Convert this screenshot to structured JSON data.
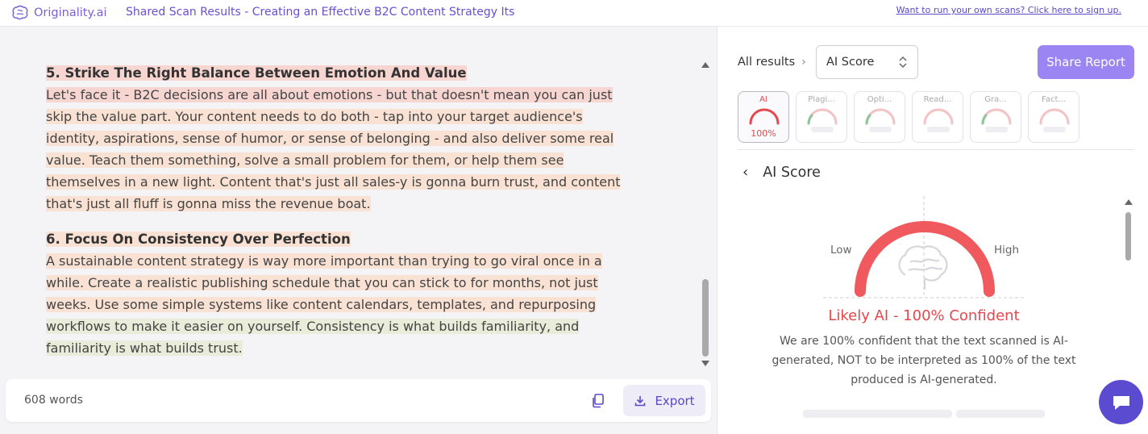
{
  "header": {
    "logo_text": "Originality.ai",
    "title": "Shared Scan Results - Creating an Effective B2C Content Strategy Its",
    "signup_link": "Want to run your own scans? Click here to sign up."
  },
  "document": {
    "section5": {
      "heading": "5. Strike The Right Balance Between Emotion And Value",
      "lines": [
        "Let's face it - B2C decisions are all about emotions - but that doesn't mean you can just",
        "skip the value part. Your content needs to do both - tap into your target audience's",
        "identity, aspirations, sense of humor, or sense of belonging - and also deliver some real",
        "value. Teach them something, solve a small problem for them, or help them see",
        "themselves in a new light. Content that's just all sales-y is gonna burn trust, and content",
        "that's just all fluff is gonna miss the revenue boat."
      ]
    },
    "section6": {
      "heading": "6. Focus On Consistency Over Perfection",
      "lines": [
        "A sustainable content strategy is way more important than trying to go viral once in a",
        "while. Create a realistic publishing schedule that you can stick to for months, not just",
        "weeks. Use some simple systems like content calendars, templates, and repurposing",
        "workflows to make it easier on yourself. Consistency is what builds familiarity, and",
        "familiarity is what builds trust."
      ]
    }
  },
  "footer": {
    "word_count": "608 words",
    "export_label": "Export"
  },
  "right": {
    "breadcrumb_label": "All results",
    "select_value": "AI Score",
    "share_label": "Share Report",
    "tabs": [
      {
        "label": "AI",
        "value": "100%"
      },
      {
        "label": "Plagi..."
      },
      {
        "label": "Opti..."
      },
      {
        "label": "Read..."
      },
      {
        "label": "Gra..."
      },
      {
        "label": "Fact..."
      }
    ],
    "section_title": "AI Score",
    "gauge_low": "Low",
    "gauge_high": "High",
    "gauge_level": 1.0,
    "verdict": "Likely AI - 100% Confident",
    "description": "We are 100% confident that the text scanned is AI-generated, NOT to be interpreted as 100% of the text produced is AI-generated."
  },
  "colors": {
    "accent": "#7a5fd6",
    "danger": "#e5484d",
    "share_button": "#9b85f2",
    "chat_button": "#5b4bd0"
  },
  "icons": [
    "brain-logo-icon",
    "chevron-right-icon",
    "up-down-icon",
    "chevron-left-icon",
    "copy-icon",
    "download-icon",
    "chat-icon"
  ]
}
